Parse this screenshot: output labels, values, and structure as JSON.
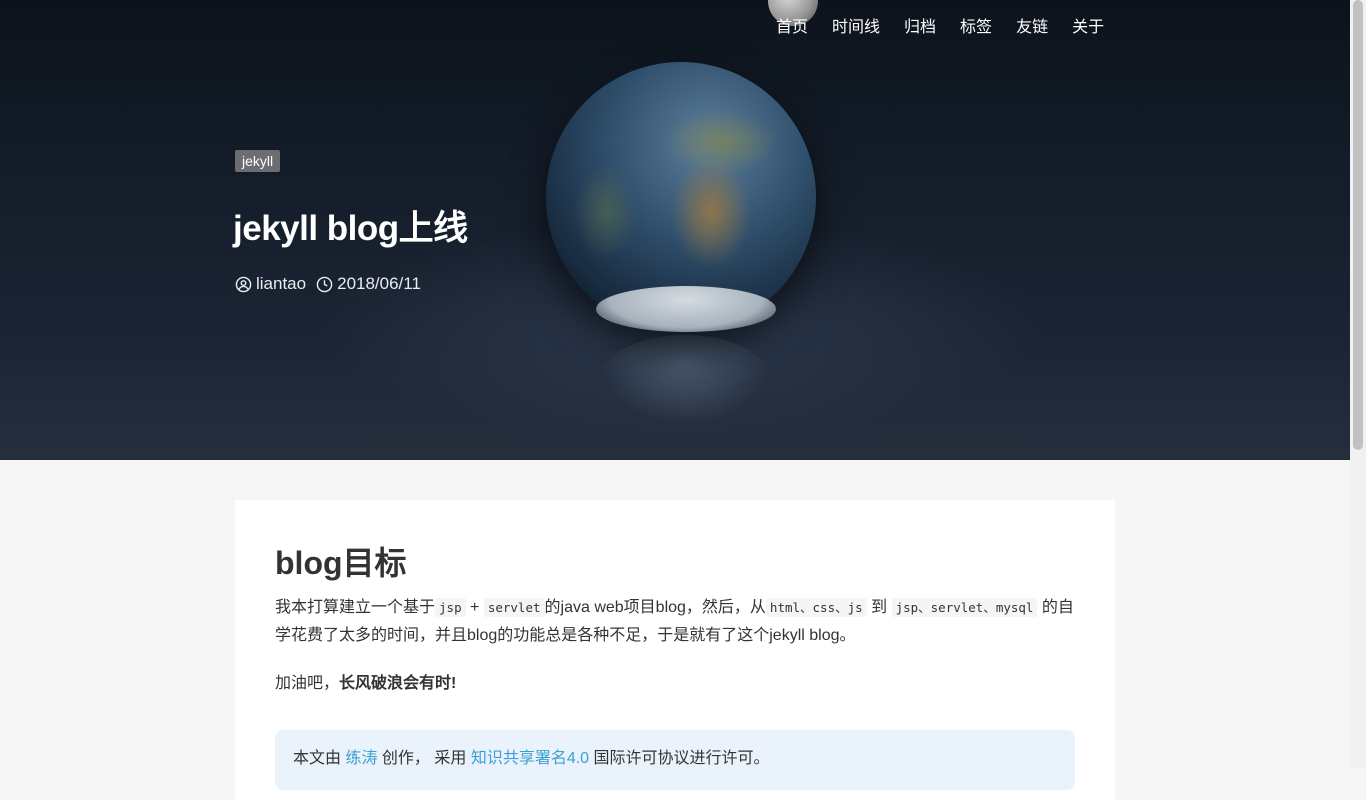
{
  "nav": {
    "items": [
      "首页",
      "时间线",
      "归档",
      "标签",
      "友链",
      "关于"
    ]
  },
  "post": {
    "tag": "jekyll",
    "title": "jekyll blog上线",
    "author": "liantao",
    "date": "2018/06/11"
  },
  "article": {
    "heading": "blog目标",
    "p1": {
      "t1": "我本打算建立一个基于",
      "c1": "jsp",
      "t2": " + ",
      "c2": "servlet",
      "t3": "的java web项目blog，然后，从",
      "c3": "html、css、js",
      "t4": " 到 ",
      "c4": "jsp、servlet、mysql",
      "t5": " 的自学花费了太多的时间，并且blog的功能总是各种不足，于是就有了这个jekyll blog。"
    },
    "p2": {
      "prefix": "加油吧，",
      "bold": "长风破浪会有时!"
    },
    "license": {
      "t1": "本文由 ",
      "author_link": "练涛",
      "t2": " 创作， 采用 ",
      "license_link": "知识共享署名4.0",
      "t3": " 国际许可协议进行许可。"
    }
  },
  "colors": {
    "link": "#3a9fd6",
    "license_bg": "#eaf3fb",
    "tag_bg": "#6b6d70"
  },
  "icons": {
    "author": "user-circle-icon",
    "date": "clock-icon"
  }
}
